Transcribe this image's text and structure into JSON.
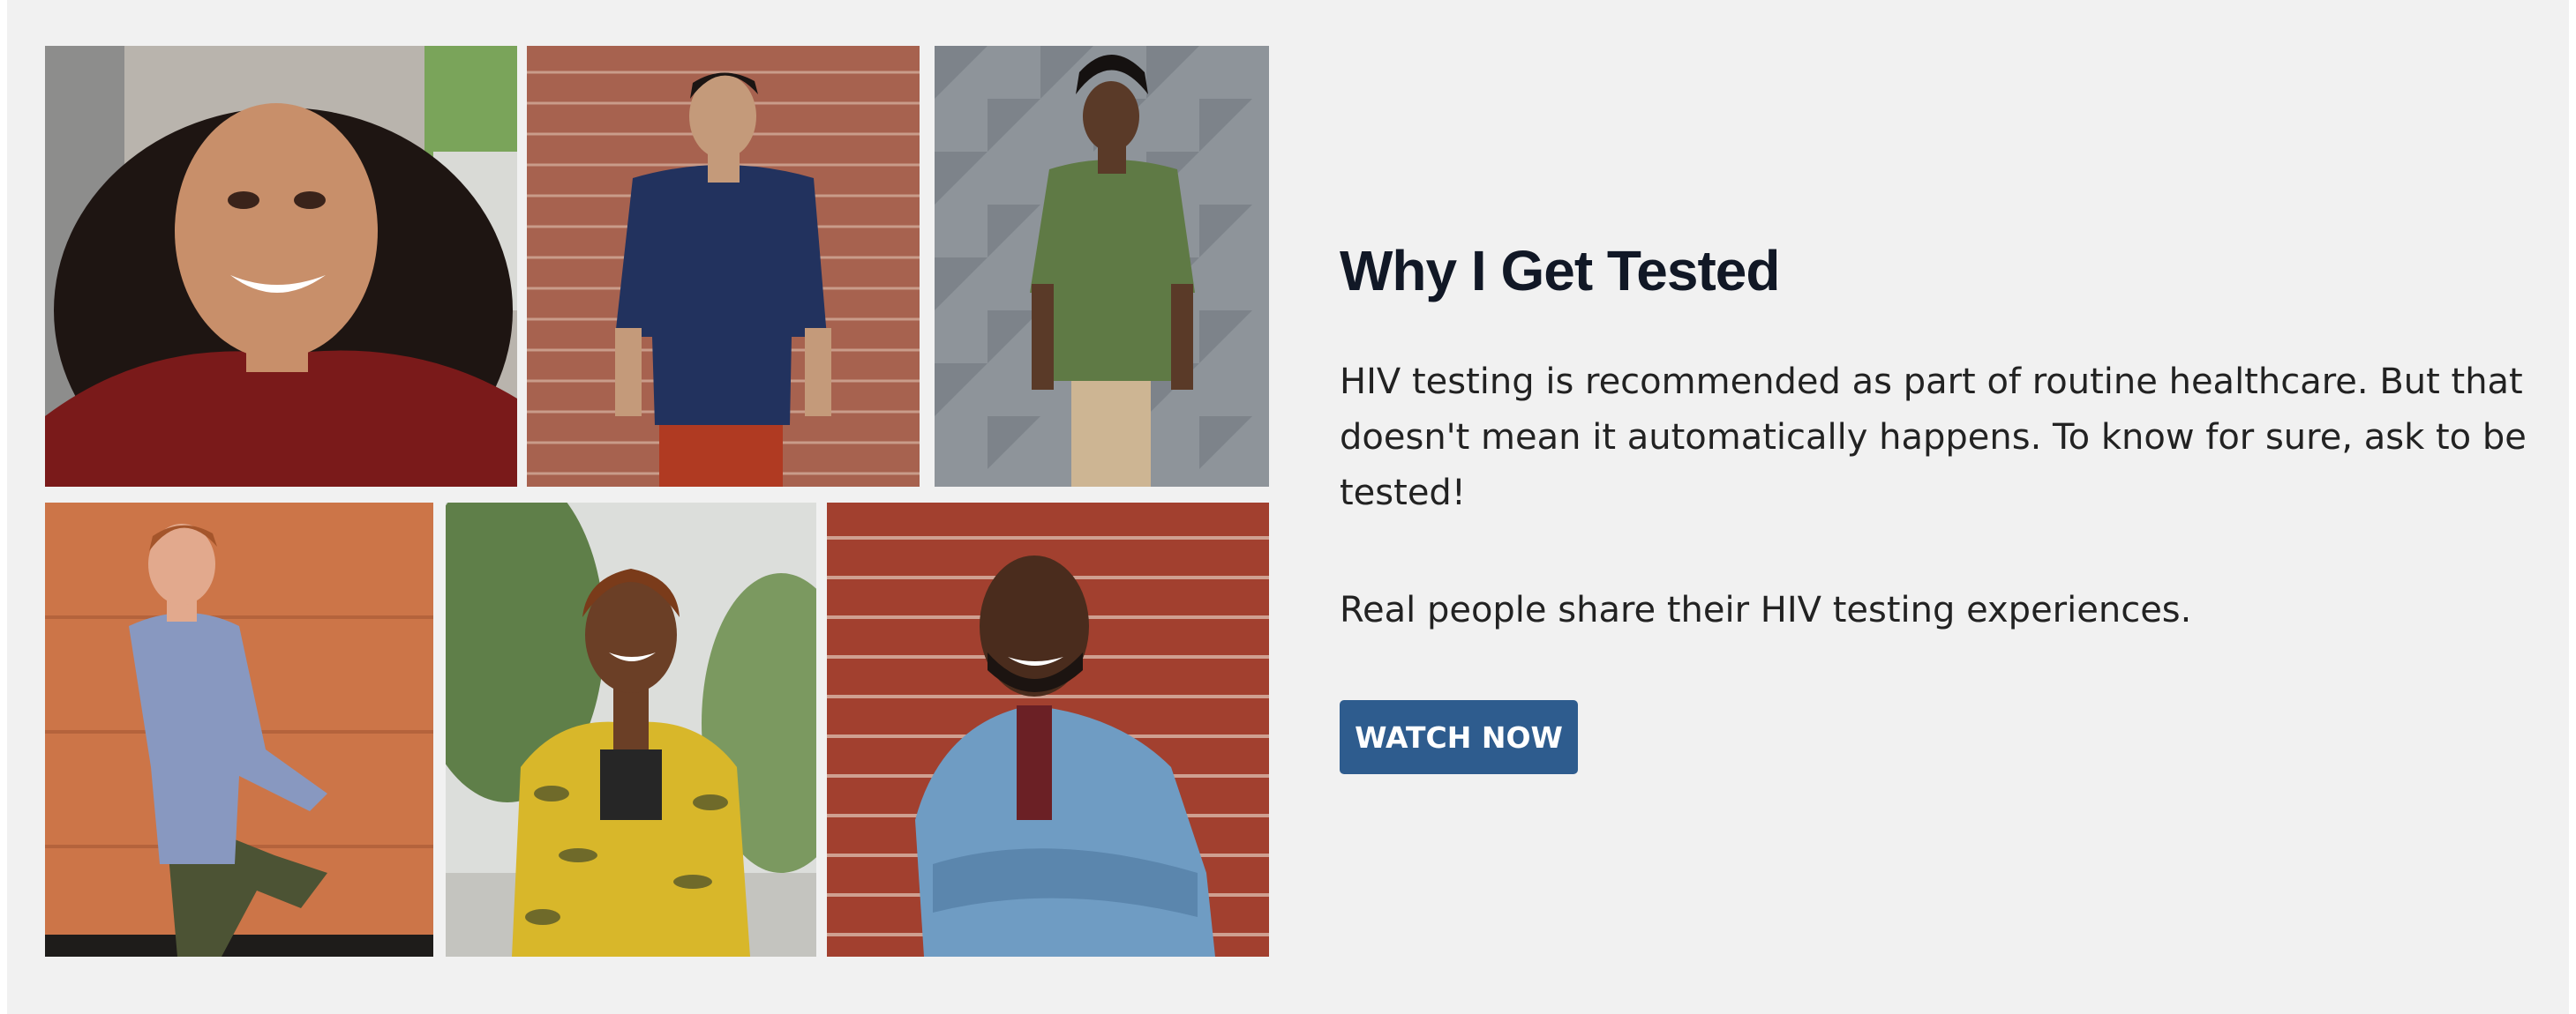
{
  "section": {
    "title": "Why I Get Tested",
    "description": "HIV testing is recommended as part of routine healthcare. But that doesn't mean it automatically happens. To know for sure, ask to be tested!",
    "tagline": "Real people share their HIV testing experiences.",
    "button_label": "WATCH NOW"
  },
  "colors": {
    "panel_background": "#f1f1f1",
    "button": "#2e5c8e",
    "title_text": "#111826"
  },
  "photos": [
    {
      "name": "photo-woman-red-blouse",
      "shirt": "#7a1a1a",
      "background": "#b7b2ab"
    },
    {
      "name": "photo-man-navy-shirt",
      "shirt": "#22325e",
      "background": "#a7604d"
    },
    {
      "name": "photo-man-green-shirt",
      "shirt": "#5f7a45",
      "background": "#8f959a"
    },
    {
      "name": "photo-man-blue-shirt",
      "shirt": "#8898c0",
      "background": "#c97347"
    },
    {
      "name": "photo-woman-yellow-top",
      "shirt": "#d8b72a",
      "background": "#8aa670"
    },
    {
      "name": "photo-man-denim-shirt",
      "shirt": "#6f9cc3",
      "background": "#a24335"
    }
  ]
}
